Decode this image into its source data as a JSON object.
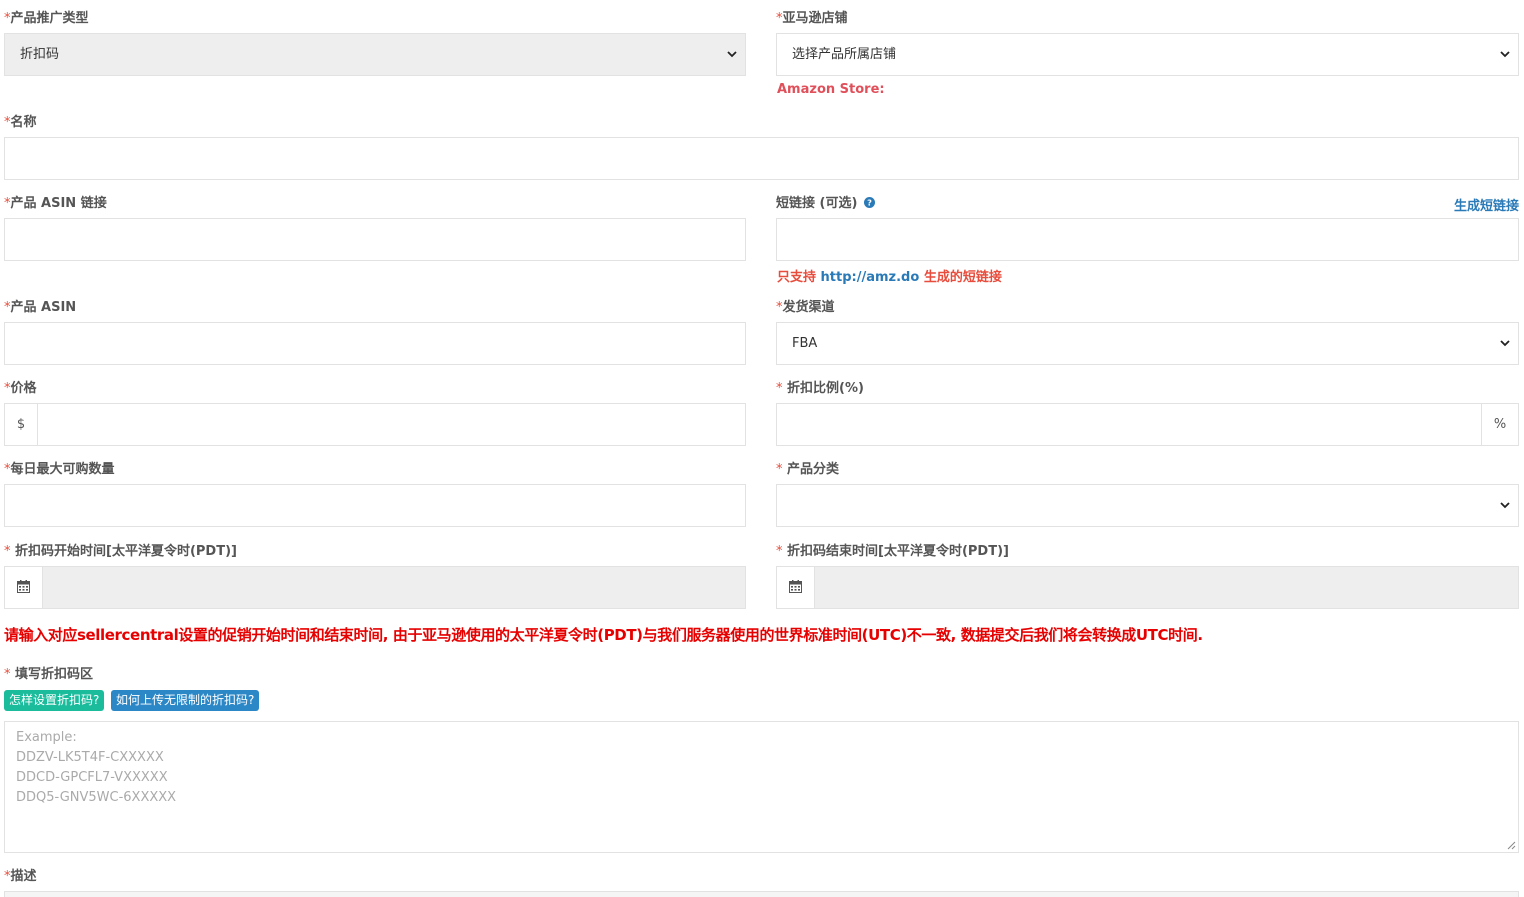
{
  "form": {
    "promo_type": {
      "label": "产品推广类型",
      "value": "折扣码"
    },
    "store": {
      "label": "亚马逊店铺",
      "value": "选择产品所属店铺",
      "hint": "Amazon Store:"
    },
    "name": {
      "label": "名称",
      "value": ""
    },
    "asin_link": {
      "label": "产品 ASIN 链接",
      "value": ""
    },
    "short_link": {
      "label": "短链接 (可选)",
      "generate_label": "生成短链接",
      "note_prefix": "只支持",
      "note_url": "http://amz.do",
      "note_suffix": "生成的短链接"
    },
    "asin": {
      "label": "产品 ASIN",
      "value": ""
    },
    "shipping": {
      "label": "发货渠道",
      "value": "FBA"
    },
    "price": {
      "label": "价格",
      "addon": "$",
      "value": ""
    },
    "discount_ratio": {
      "label": " 折扣比例(%)",
      "addon": "%",
      "value": ""
    },
    "daily_max": {
      "label": "每日最大可购数量",
      "value": ""
    },
    "category": {
      "label": " 产品分类",
      "value": ""
    },
    "start_time": {
      "label": " 折扣码开始时间[太平洋夏令时(PDT)]",
      "value": ""
    },
    "end_time": {
      "label": " 折扣码结束时间[太平洋夏令时(PDT)]",
      "value": ""
    },
    "time_notice": "请输入对应sellercentral设置的促销开始时间和结束时间, 由于亚马逊使用的太平洋夏令时(PDT)与我们服务器使用的世界标准时间(UTC)不一致, 数据提交后我们将会转换成UTC时间.",
    "codes": {
      "label": " 填写折扣码区",
      "help_button_1": "怎样设置折扣码?",
      "help_button_2": "如何上传无限制的折扣码?",
      "placeholder_lines": [
        "Example:",
        "DDZV-LK5T4F-CXXXXX",
        "DDCD-GPCFL7-VXXXXX",
        "DDQ5-GNV5WC-6XXXXX"
      ]
    },
    "description": {
      "label": "描述"
    },
    "required_mark": "*"
  },
  "colors": {
    "required": "#e74c3c",
    "link": "#2a7ab8",
    "badge_green": "#1abc9c",
    "badge_blue": "#2c87c7",
    "notice": "#e60000"
  },
  "icons": {
    "select_arrow": "chevron-down-icon",
    "help": "question-circle-icon",
    "calendar": "calendar-icon"
  }
}
